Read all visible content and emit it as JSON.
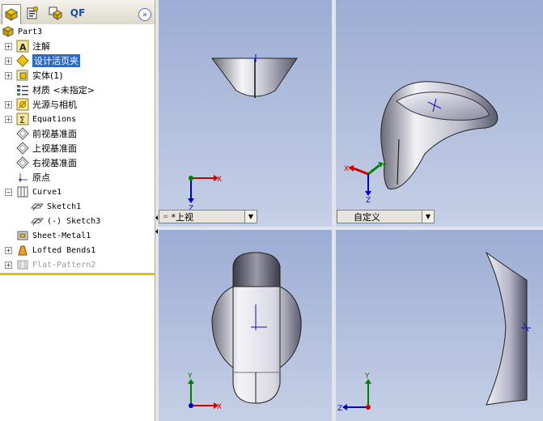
{
  "feature_manager": {
    "tabs": [
      {
        "icon": "feature-tree-icon"
      },
      {
        "icon": "property-manager-icon"
      },
      {
        "icon": "configuration-manager-icon"
      },
      {
        "label": "QF"
      }
    ],
    "collapse_label": "»",
    "tree": [
      {
        "label": "Part3",
        "icon": "part-icon"
      },
      {
        "label": "注解",
        "icon": "annotations-icon"
      },
      {
        "label": "设计活页夹",
        "icon": "design-binder-icon",
        "selected": true
      },
      {
        "label": "实体(1)",
        "icon": "solid-bodies-icon"
      },
      {
        "label": "材质 <未指定>",
        "icon": "material-icon"
      },
      {
        "label": "光源与相机",
        "icon": "lights-cameras-icon"
      },
      {
        "label": "Equations",
        "icon": "equations-icon"
      },
      {
        "label": "前视基准面",
        "icon": "plane-icon"
      },
      {
        "label": "上视基准面",
        "icon": "plane-icon"
      },
      {
        "label": "右视基准面",
        "icon": "plane-icon"
      },
      {
        "label": "原点",
        "icon": "origin-icon"
      },
      {
        "label": "Curve1",
        "icon": "curve-icon"
      },
      {
        "label": "Sketch1",
        "icon": "sketch-icon"
      },
      {
        "label": "(-) Sketch3",
        "icon": "sketch-icon"
      },
      {
        "label": "Sheet-Metal1",
        "icon": "sheet-metal-icon"
      },
      {
        "label": "Lofted Bends1",
        "icon": "lofted-bends-icon"
      },
      {
        "label": "Flat-Pattern2",
        "icon": "flat-pattern-icon",
        "suppressed": true
      }
    ]
  },
  "viewports": {
    "top_left": {
      "view_label": "*上视"
    },
    "top_right": {
      "view_label": "自定义"
    },
    "axes": {
      "x": "X",
      "y": "Y",
      "z": "Z"
    }
  },
  "colors": {
    "selection": "#316ac5",
    "viewport_top": "#9cadd4",
    "viewport_bottom": "#c6d0e6",
    "accent_line": "#e0c000",
    "axis_x": "#cc0000",
    "axis_y": "#008000",
    "axis_z": "#0000cc"
  }
}
